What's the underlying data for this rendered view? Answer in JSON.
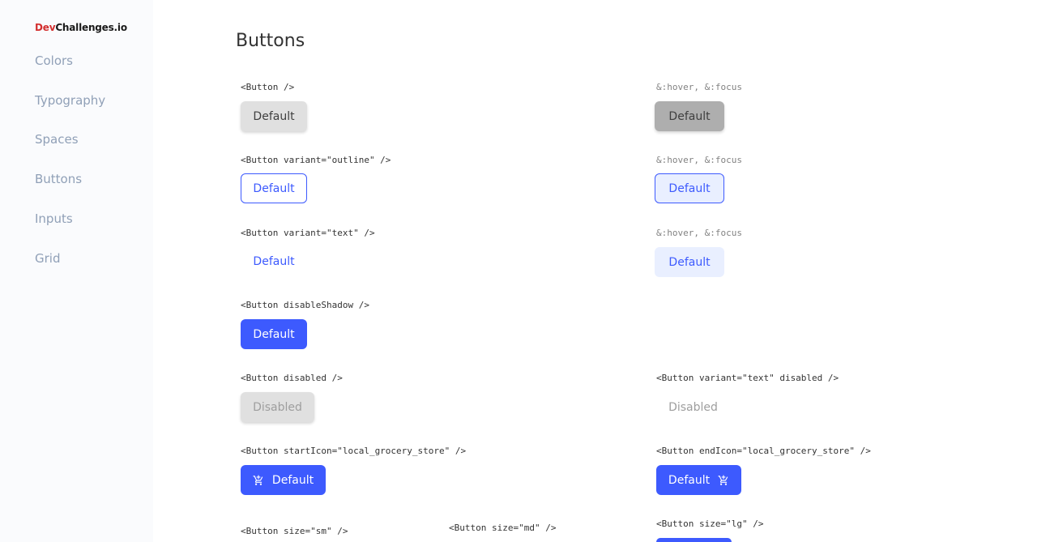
{
  "logo": {
    "dev": "Dev",
    "rest": "Challenges.io"
  },
  "sidebar": {
    "items": [
      {
        "label": "Colors"
      },
      {
        "label": "Typography"
      },
      {
        "label": "Spaces"
      },
      {
        "label": "Buttons"
      },
      {
        "label": "Inputs"
      },
      {
        "label": "Grid"
      }
    ]
  },
  "page": {
    "title": "Buttons"
  },
  "rows": {
    "default": {
      "label": "<Button />",
      "hover_label": "&:hover, &:focus",
      "button": "Default",
      "hover_button": "Default"
    },
    "outline": {
      "label": "<Button variant=\"outline\" />",
      "hover_label": "&:hover, &:focus",
      "button": "Default",
      "hover_button": "Default"
    },
    "text": {
      "label": "<Button variant=\"text\" />",
      "hover_label": "&:hover, &:focus",
      "button": "Default",
      "hover_button": "Default"
    },
    "disable_shadow": {
      "label": "<Button disableShadow />",
      "button": "Default"
    },
    "disabled": {
      "label": "<Button disabled />",
      "button": "Disabled",
      "text_label": "<Button variant=\"text\" disabled />",
      "text_button": "Disabled"
    },
    "icons": {
      "start_label": "<Button startIcon=\"local_grocery_store\" />",
      "start_button": "Default",
      "end_label": "<Button endIcon=\"local_grocery_store\" />",
      "end_button": "Default",
      "icon": "cart-icon"
    },
    "sizes": {
      "sm_label": "<Button size=\"sm\" />",
      "md_label": "<Button size=\"md\" />",
      "lg_label": "<Button size=\"lg\" />"
    }
  },
  "colors": {
    "primary": "#3D5AFE",
    "default_bg": "#E0E0E0",
    "logo_red": "#D32F2F",
    "nav_text": "#90A0B7"
  }
}
